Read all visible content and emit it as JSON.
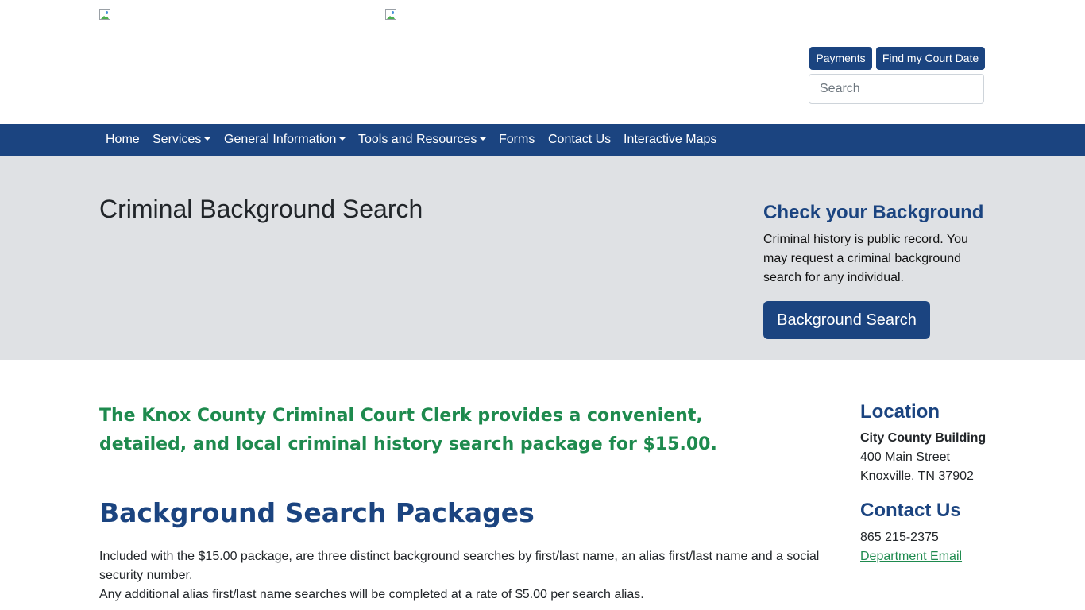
{
  "header": {
    "logos": [
      "broken-image-icon",
      "broken-image-icon"
    ],
    "buttons": {
      "payments": "Payments",
      "find_court_date": "Find my Court Date"
    },
    "search": {
      "placeholder": "Search",
      "value": ""
    }
  },
  "nav": {
    "items": [
      {
        "label": "Home",
        "dropdown": false
      },
      {
        "label": "Services",
        "dropdown": true
      },
      {
        "label": "General Information",
        "dropdown": true
      },
      {
        "label": "Tools and Resources",
        "dropdown": true
      },
      {
        "label": "Forms",
        "dropdown": false
      },
      {
        "label": "Contact Us",
        "dropdown": false
      },
      {
        "label": "Interactive Maps",
        "dropdown": false
      }
    ]
  },
  "hero": {
    "title": "Criminal Background Search",
    "side": {
      "title": "Check your Background",
      "text": "Criminal history is public record. You may request a criminal background search for any individual.",
      "button": "Background Search"
    }
  },
  "main": {
    "intro": "The Knox County Criminal Court Clerk provides a convenient, detailed, and local criminal history search package for $15.00.",
    "heading": "Background Search Packages",
    "paragraphs": [
      "Included with the $15.00 package, are three distinct background searches by first/last name, an alias first/last name and a social security number.",
      "Any additional alias first/last name searches will be completed at a rate of $5.00 per search alias."
    ]
  },
  "sidebar": {
    "location_title": "Location",
    "building": "City County Building",
    "street": "400 Main Street",
    "city": "Knoxville, TN 37902",
    "contact_title": "Contact Us",
    "phone": "865 215-2375",
    "email_link": "Department Email"
  },
  "colors": {
    "primary": "#1b4480",
    "accent_green": "#1e8a4e",
    "hero_bg": "#dfe1e4"
  }
}
